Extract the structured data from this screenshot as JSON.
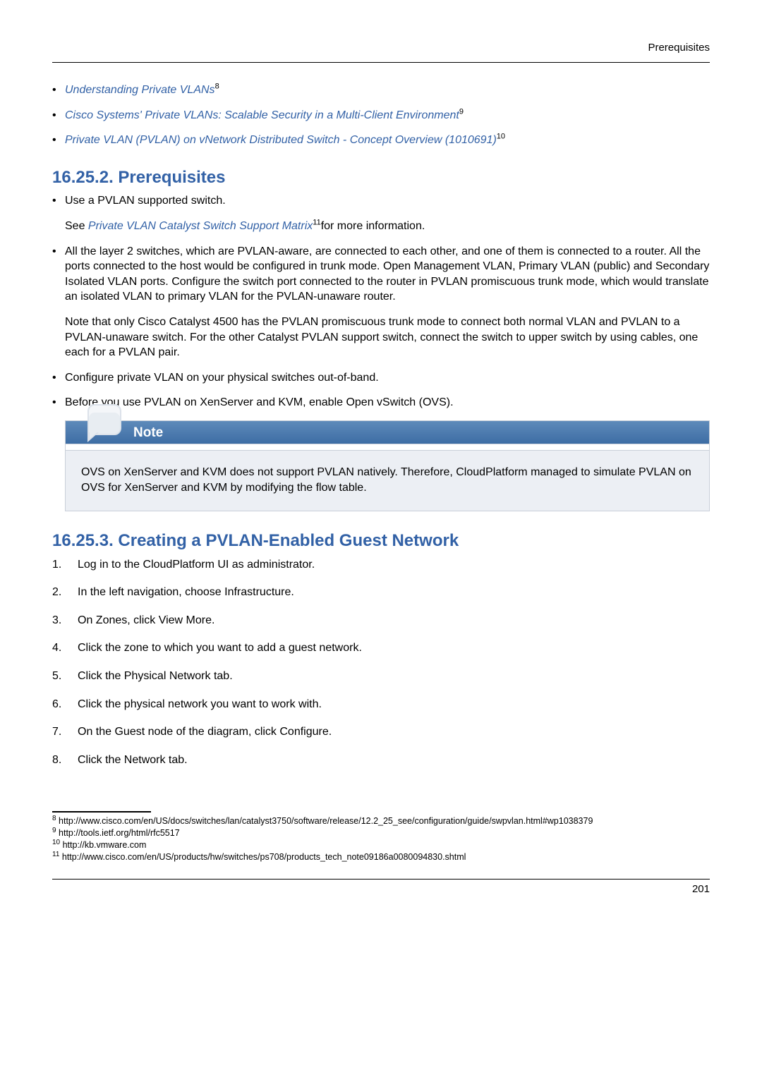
{
  "header": {
    "running_title": "Prerequisites"
  },
  "top_links": [
    {
      "text": "Understanding Private VLANs",
      "sup": "8"
    },
    {
      "text": "Cisco Systems' Private VLANs: Scalable Security in a Multi-Client Environment",
      "sup": "9"
    },
    {
      "text": "Private VLAN (PVLAN) on vNetwork Distributed Switch - Concept Overview (1010691)",
      "sup": "10"
    }
  ],
  "section_prereq": {
    "heading": "16.25.2. Prerequisites",
    "items": [
      {
        "first": "Use a PVLAN supported switch.",
        "see_prefix": "See ",
        "see_link": "Private VLAN Catalyst Switch Support Matrix",
        "see_sup": "11",
        "see_suffix": "for more information."
      },
      {
        "para1": "All the layer 2 switches, which are PVLAN-aware, are connected to each other, and one of them is connected to a router. All the ports connected to the host would be configured in trunk mode. Open Management VLAN, Primary VLAN (public) and Secondary Isolated VLAN ports. Configure the switch port connected to the router in PVLAN promiscuous trunk mode, which would translate an isolated VLAN to primary VLAN for the PVLAN-unaware router.",
        "para2": "Note that only Cisco Catalyst 4500 has the PVLAN promiscuous trunk mode to connect both normal VLAN and PVLAN to a PVLAN-unaware switch. For the other Catalyst PVLAN support switch, connect the switch to upper switch by using cables, one each for a PVLAN pair."
      },
      {
        "single": "Configure private VLAN on your physical switches out-of-band."
      },
      {
        "single": "Before you use PVLAN on XenServer and KVM, enable Open vSwitch (OVS)."
      }
    ]
  },
  "note": {
    "title": "Note",
    "body": "OVS on XenServer and KVM does not support PVLAN natively. Therefore, CloudPlatform managed to simulate PVLAN on OVS for XenServer and KVM by modifying the flow table."
  },
  "section_create": {
    "heading": "16.25.3. Creating a PVLAN-Enabled Guest Network",
    "steps": [
      "Log in to the CloudPlatform UI as administrator.",
      "In the left navigation, choose Infrastructure.",
      "On Zones, click View More.",
      "Click the zone to which you want to add a guest network.",
      "Click the Physical Network tab.",
      "Click the physical network you want to work with.",
      "On the Guest node of the diagram, click Configure.",
      "Click the Network tab."
    ]
  },
  "footnotes": [
    {
      "num": "8",
      "text": " http://www.cisco.com/en/US/docs/switches/lan/catalyst3750/software/release/12.2_25_see/configuration/guide/swpvlan.html#wp1038379"
    },
    {
      "num": "9",
      "text": " http://tools.ietf.org/html/rfc5517"
    },
    {
      "num": "10",
      "text": " http://kb.vmware.com"
    },
    {
      "num": "11",
      "text": " http://www.cisco.com/en/US/products/hw/switches/ps708/products_tech_note09186a0080094830.shtml"
    }
  ],
  "page_number": "201"
}
